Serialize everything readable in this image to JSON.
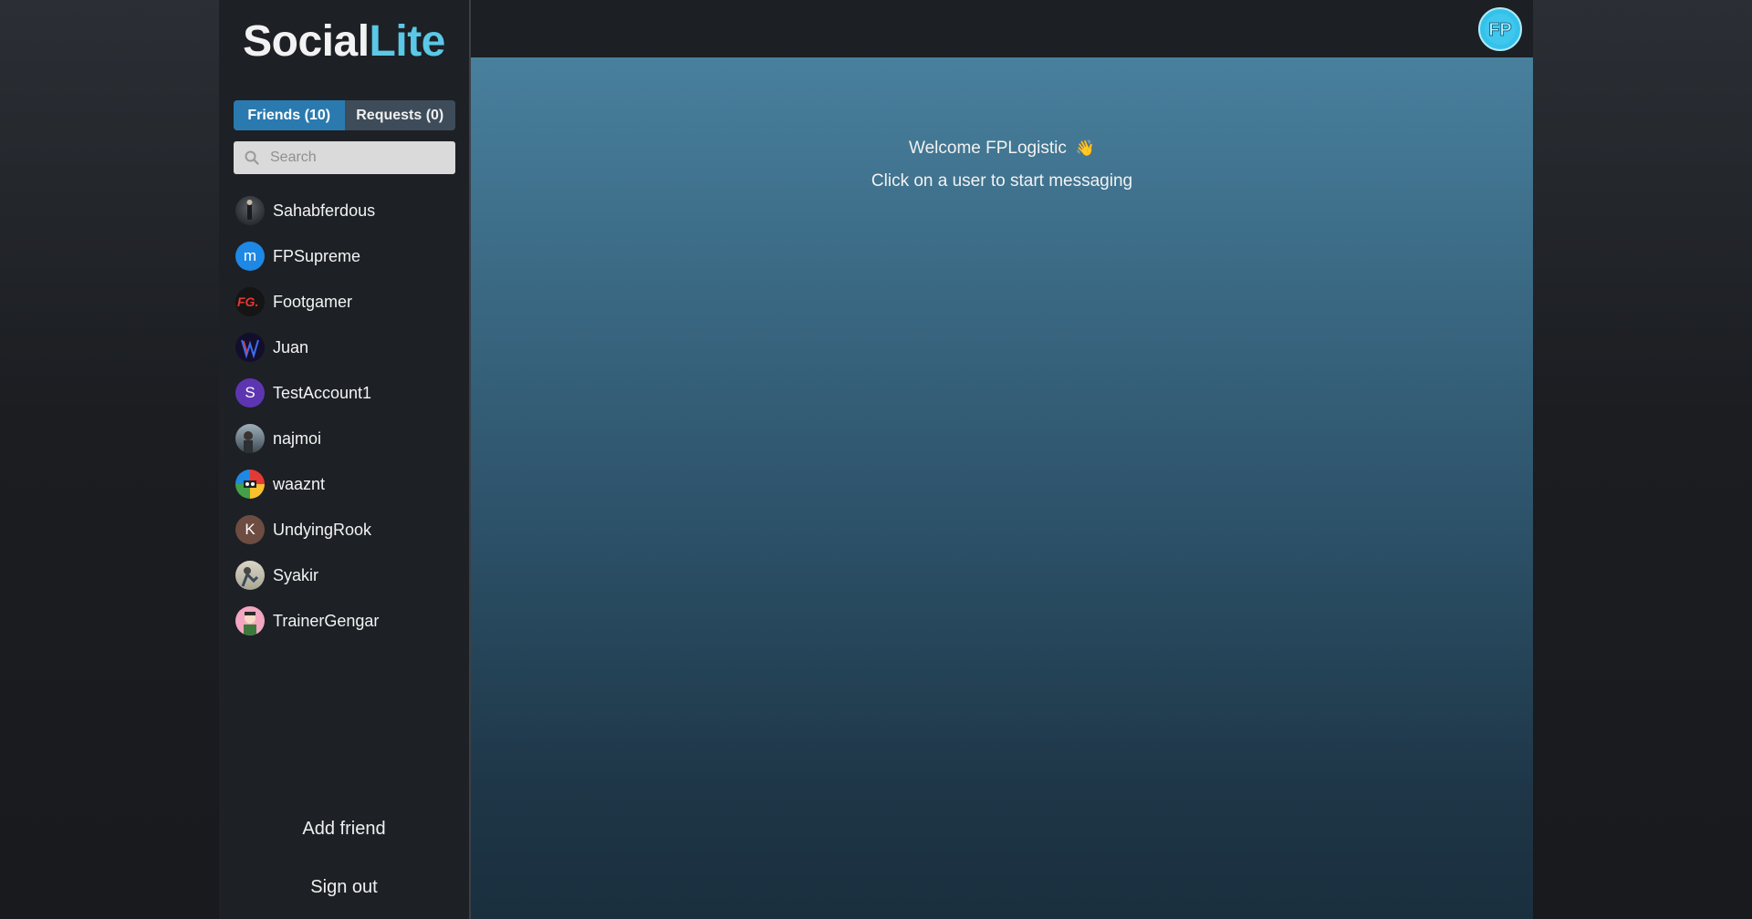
{
  "brand": {
    "part1": "Social",
    "part2": "Lite"
  },
  "tabs": {
    "friends": "Friends (10)",
    "requests": "Requests (0)"
  },
  "search": {
    "placeholder": "Search",
    "value": ""
  },
  "friends": [
    {
      "name": "Sahabferdous",
      "initial": "",
      "avatar_color": "#3a3d42"
    },
    {
      "name": "FPSupreme",
      "initial": "m",
      "avatar_color": "#1e88e5"
    },
    {
      "name": "Footgamer",
      "initial": "",
      "avatar_color": "#1a1a1a"
    },
    {
      "name": "Juan",
      "initial": "",
      "avatar_color": "#1b1440"
    },
    {
      "name": "TestAccount1",
      "initial": "S",
      "avatar_color": "#5e35b1"
    },
    {
      "name": "najmoi",
      "initial": "",
      "avatar_color": "#7c8a94"
    },
    {
      "name": "waaznt",
      "initial": "",
      "avatar_color": "#4caf50"
    },
    {
      "name": "UndyingRook",
      "initial": "K",
      "avatar_color": "#6d4c41"
    },
    {
      "name": "Syakir",
      "initial": "",
      "avatar_color": "#b8b6a6"
    },
    {
      "name": "TrainerGengar",
      "initial": "",
      "avatar_color": "#f3a6c0"
    }
  ],
  "sidebar_actions": {
    "add_friend": "Add friend",
    "sign_out": "Sign out"
  },
  "profile": {
    "initials": "FP",
    "color": "#35c2ea"
  },
  "welcome": {
    "line1": "Welcome FPLogistic",
    "emoji": "👋",
    "line2": "Click on a user to start messaging"
  }
}
